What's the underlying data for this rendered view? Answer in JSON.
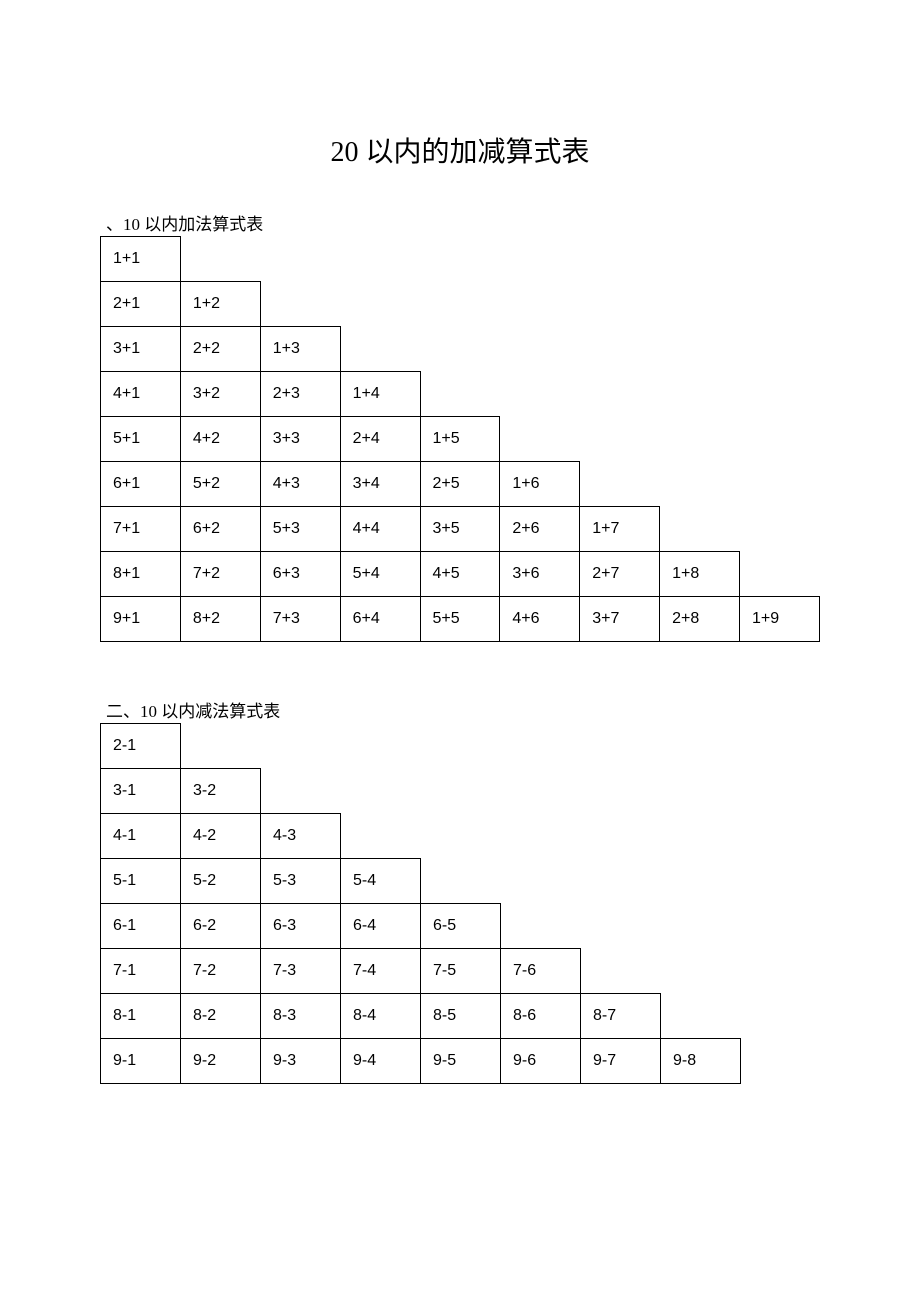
{
  "title": "20 以内的加减算式表",
  "section1_heading": "、10 以内加法算式表",
  "section2_heading": "二、10 以内减法算式表",
  "addition": [
    [
      "1+1"
    ],
    [
      "2+1",
      "1+2"
    ],
    [
      "3+1",
      "2+2",
      "1+3"
    ],
    [
      "4+1",
      "3+2",
      "2+3",
      "1+4"
    ],
    [
      "5+1",
      "4+2",
      "3+3",
      "2+4",
      "1+5"
    ],
    [
      "6+1",
      "5+2",
      "4+3",
      "3+4",
      "2+5",
      "1+6"
    ],
    [
      "7+1",
      "6+2",
      "5+3",
      "4+4",
      "3+5",
      "2+6",
      "1+7"
    ],
    [
      "8+1",
      "7+2",
      "6+3",
      "5+4",
      "4+5",
      "3+6",
      "2+7",
      "1+8"
    ],
    [
      "9+1",
      "8+2",
      "7+3",
      "6+4",
      "5+5",
      "4+6",
      "3+7",
      "2+8",
      "1+9"
    ]
  ],
  "subtraction": [
    [
      "2-1"
    ],
    [
      "3-1",
      "3-2"
    ],
    [
      "4-1",
      "4-2",
      "4-3"
    ],
    [
      "5-1",
      "5-2",
      "5-3",
      "5-4"
    ],
    [
      "6-1",
      "6-2",
      "6-3",
      "6-4",
      "6-5"
    ],
    [
      "7-1",
      "7-2",
      "7-3",
      "7-4",
      "7-5",
      "7-6"
    ],
    [
      "8-1",
      "8-2",
      "8-3",
      "8-4",
      "8-5",
      "8-6",
      "8-7"
    ],
    [
      "9-1",
      "9-2",
      "9-3",
      "9-4",
      "9-5",
      "9-6",
      "9-7",
      "9-8"
    ]
  ],
  "chart_data": [
    {
      "type": "table",
      "title": "10 以内加法算式表",
      "rows": [
        [
          "1+1"
        ],
        [
          "2+1",
          "1+2"
        ],
        [
          "3+1",
          "2+2",
          "1+3"
        ],
        [
          "4+1",
          "3+2",
          "2+3",
          "1+4"
        ],
        [
          "5+1",
          "4+2",
          "3+3",
          "2+4",
          "1+5"
        ],
        [
          "6+1",
          "5+2",
          "4+3",
          "3+4",
          "2+5",
          "1+6"
        ],
        [
          "7+1",
          "6+2",
          "5+3",
          "4+4",
          "3+5",
          "2+6",
          "1+7"
        ],
        [
          "8+1",
          "7+2",
          "6+3",
          "5+4",
          "4+5",
          "3+6",
          "2+7",
          "1+8"
        ],
        [
          "9+1",
          "8+2",
          "7+3",
          "6+4",
          "5+5",
          "4+6",
          "3+7",
          "2+8",
          "1+9"
        ]
      ]
    },
    {
      "type": "table",
      "title": "10 以内减法算式表",
      "rows": [
        [
          "2-1"
        ],
        [
          "3-1",
          "3-2"
        ],
        [
          "4-1",
          "4-2",
          "4-3"
        ],
        [
          "5-1",
          "5-2",
          "5-3",
          "5-4"
        ],
        [
          "6-1",
          "6-2",
          "6-3",
          "6-4",
          "6-5"
        ],
        [
          "7-1",
          "7-2",
          "7-3",
          "7-4",
          "7-5",
          "7-6"
        ],
        [
          "8-1",
          "8-2",
          "8-3",
          "8-4",
          "8-5",
          "8-6",
          "8-7"
        ],
        [
          "9-1",
          "9-2",
          "9-3",
          "9-4",
          "9-5",
          "9-6",
          "9-7",
          "9-8"
        ]
      ]
    }
  ]
}
